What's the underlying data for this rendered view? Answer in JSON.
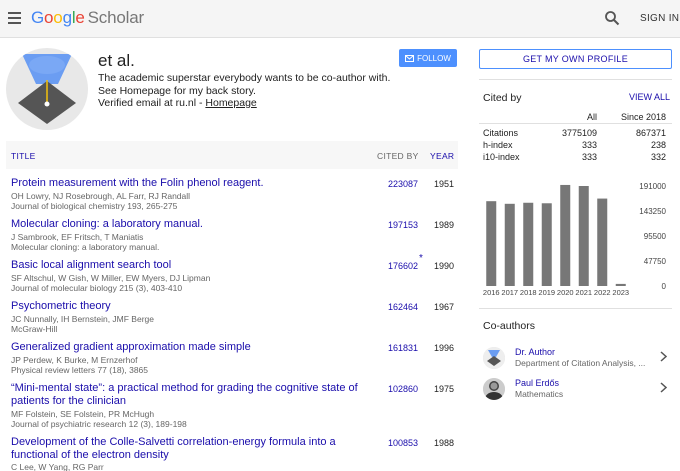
{
  "header": {
    "logo_google": "Google",
    "logo_scholar": "Scholar",
    "signin": "SIGN IN",
    "menu_icon": "hamburger-menu-icon",
    "search_icon": "search-icon"
  },
  "profile": {
    "name": "et al.",
    "bio": "The academic superstar everybody wants to be co-author with. See Homepage for my back story.",
    "verified_prefix": "Verified email at ru.nl - ",
    "homepage_link": "Homepage",
    "follow": "FOLLOW",
    "get_profile": "GET MY OWN PROFILE"
  },
  "table": {
    "col_title": "TITLE",
    "col_cited": "CITED BY",
    "col_year": "YEAR",
    "rows": [
      {
        "title": "Protein measurement with the Folin phenol reagent.",
        "authors": "OH Lowry, NJ Rosebrough, AL Farr, RJ Randall",
        "journal": "Journal of biological chemistry 193, 265-275",
        "cited": "223087",
        "year": "1951",
        "star": ""
      },
      {
        "title": "Molecular cloning: a laboratory manual.",
        "authors": "J Sambrook, EF Fritsch, T Maniatis",
        "journal": "Molecular cloning: a laboratory manual.",
        "cited": "197153",
        "year": "1989",
        "star": ""
      },
      {
        "title": "Basic local alignment search tool",
        "authors": "SF Altschul, W Gish, W Miller, EW Myers, DJ Lipman",
        "journal": "Journal of molecular biology 215 (3), 403-410",
        "cited": "176602",
        "year": "1990",
        "star": "*"
      },
      {
        "title": "Psychometric theory",
        "authors": "JC Nunnally, IH Bernstein, JMF Berge",
        "journal": "McGraw-Hill",
        "cited": "162464",
        "year": "1967",
        "star": ""
      },
      {
        "title": "Generalized gradient approximation made simple",
        "authors": "JP Perdew, K Burke, M Ernzerhof",
        "journal": "Physical review letters 77 (18), 3865",
        "cited": "161831",
        "year": "1996",
        "star": ""
      },
      {
        "title": "“Mini-mental state”: a practical method for grading the cognitive state of patients for the clinician",
        "authors": "MF Folstein, SE Folstein, PR McHugh",
        "journal": "Journal of psychiatric research 12 (3), 189-198",
        "cited": "102860",
        "year": "1975",
        "star": ""
      },
      {
        "title": "Development of the Colle-Salvetti correlation-energy formula into a functional of the electron density",
        "authors": "C Lee, W Yang, RG Parr",
        "journal": "",
        "cited": "100853",
        "year": "1988",
        "star": ""
      }
    ]
  },
  "cited_by": {
    "title": "Cited by",
    "view_all": "VIEW ALL",
    "col_all": "All",
    "col_since": "Since 2018",
    "stats": [
      {
        "label": "Citations",
        "all": "3775109",
        "since": "867371"
      },
      {
        "label": "h-index",
        "all": "333",
        "since": "238"
      },
      {
        "label": "i10-index",
        "all": "333",
        "since": "332"
      }
    ]
  },
  "chart_data": {
    "type": "bar",
    "categories": [
      "2016",
      "2017",
      "2018",
      "2019",
      "2020",
      "2021",
      "2022",
      "2023"
    ],
    "values": [
      162000,
      157000,
      159000,
      158000,
      193000,
      191000,
      167000,
      4000
    ],
    "ylim": [
      0,
      191000
    ],
    "yticks": [
      "191000",
      "143250",
      "95500",
      "47750",
      "0"
    ],
    "bar_color": "#777777"
  },
  "coauthors": {
    "title": "Co-authors",
    "items": [
      {
        "name": "Dr. Author",
        "affiliation": "Department of Citation Analysis, ..."
      },
      {
        "name": "Paul Erdős",
        "affiliation": "Mathematics"
      }
    ]
  },
  "colors": {
    "link": "#1a0dab",
    "accent": "#4d90fe"
  }
}
